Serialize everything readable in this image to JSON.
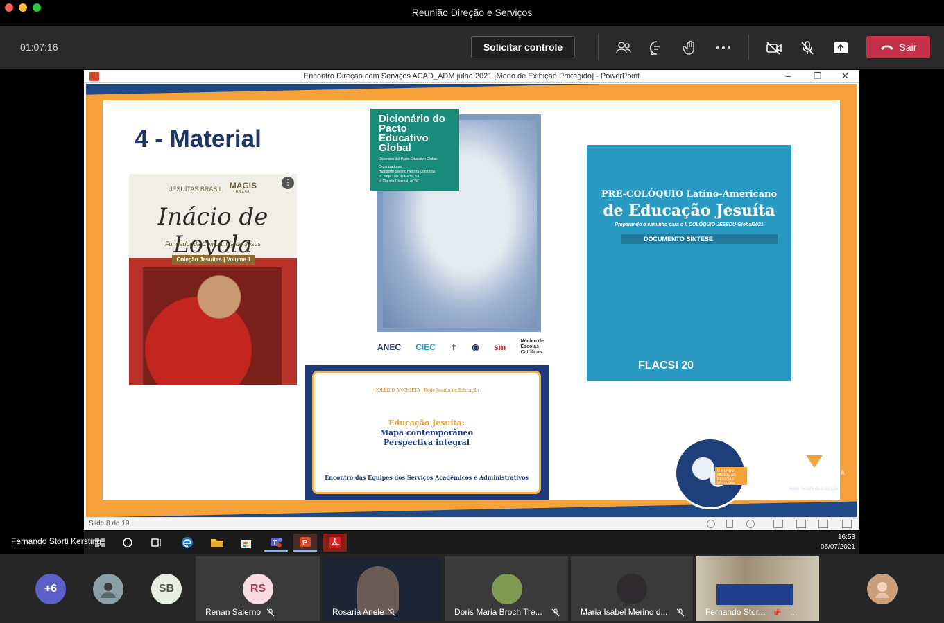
{
  "window": {
    "title": "Reunião Direção e Serviços"
  },
  "toolbar": {
    "timer": "01:07:16",
    "request_control": "Solicitar controle",
    "leave": "Sair"
  },
  "powerpoint": {
    "title": "Encontro Direção com Serviços ACAD_ADM julho 2021 [Modo de Exibição Protegido] - PowerPoint",
    "status": "Slide 8 de 19"
  },
  "slide": {
    "heading": "4 - Material",
    "book1": {
      "publisher1": "JESUÍTAS BRASIL",
      "publisher2": "MAGIS",
      "publisher2_sub": "BRASIL",
      "title": "Inácio de Loyola",
      "subtitle": "Fundador da Companhia de Jesus",
      "band": "Coleção Jesuítas | Volume 1"
    },
    "book2": {
      "title": "Dicionário do Pacto Educativo Global",
      "line1": "Dicionário del Pacto Educativo Global",
      "line2": "Organizadores:",
      "line3": "Humberto Silvano Herrera Contreras",
      "line4": "Ir. Jorge Luis de Paula, SJ",
      "line5": "Ir. Claudia Chaxiral, ACSC"
    },
    "logos": {
      "anec": "ANEC",
      "ciec": "CIEC",
      "sm": "sm",
      "nucleo1": "Núcleo de",
      "nucleo2": "Escolas",
      "nucleo3": "Católicas"
    },
    "book3": {
      "pre": "PRE-COLÓQUIO Latino-Americano",
      "title": "de Educação Jesuíta",
      "sub": "Preparando o caminho para o II COLÓQUIO JESEDU-Global2021",
      "band": "DOCUMENTO SÍNTESE",
      "foot": "FLACSI 20"
    },
    "slide4": {
      "top": "COLÉGIO ANCHIETA | Rede Jesuíta de Educação",
      "line1": "Educação Jesuíta:",
      "line2": "Mapa contemporâneo",
      "line3": "Perspectiva integral",
      "foot": "Encontro das Equipes dos Serviços Acadêmicos e Administrativos"
    },
    "globe_tag": "O MUNDO MUDOU AS PESSOAS MUDARAM",
    "anchieta": "COLÉGIO ANCHIETA",
    "rede": "Rede Jesuíta de Educação"
  },
  "taskbar": {
    "time": "16:53",
    "date": "05/07/2021"
  },
  "presenter": "Fernando Storti Kersting",
  "gallery": {
    "overflow": "+6",
    "initials_sb": "SB",
    "initials_rs": "RS",
    "tiles": [
      {
        "name": "Renan Salerno"
      },
      {
        "name": "Rosaria Anele"
      },
      {
        "name": "Doris Maria Broch Tre..."
      },
      {
        "name": "Maria Isabel Merino d..."
      },
      {
        "name": "Fernando Stor..."
      }
    ]
  },
  "colors": {
    "leave": "#c4314b",
    "slide_blue": "#1f4a86",
    "slide_orange": "#f6a13a",
    "flacsi_teal": "#2a9ac3"
  }
}
